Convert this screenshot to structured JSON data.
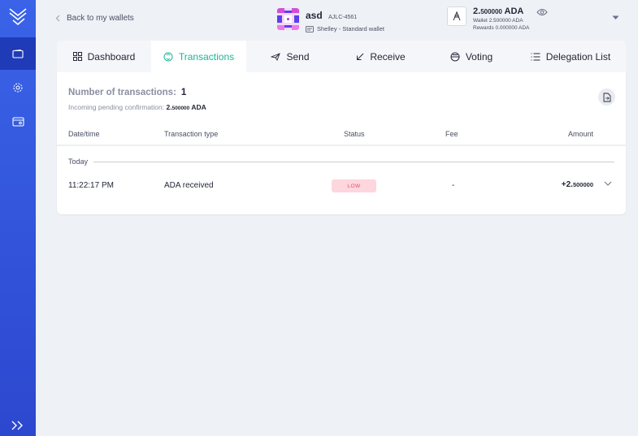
{
  "nav": {
    "back_label": "Back to my wallets"
  },
  "wallet": {
    "name": "asd",
    "plate": "AJLC-4561",
    "type": "Shelley - Standard wallet"
  },
  "balance": {
    "main_int": "2.",
    "main_dec": "500000",
    "main_unit": " ADA",
    "wallet_line": "Wallet 2.500000 ADA",
    "rewards_line": "Rewards 0.000000 ADA"
  },
  "tabs": [
    {
      "label": "Dashboard",
      "icon": "grid-icon",
      "active": false
    },
    {
      "label": "Transactions",
      "icon": "transactions-icon",
      "active": true
    },
    {
      "label": "Send",
      "icon": "send-icon",
      "active": false
    },
    {
      "label": "Receive",
      "icon": "receive-icon",
      "active": false
    },
    {
      "label": "Voting",
      "icon": "voting-icon",
      "active": false
    },
    {
      "label": "Delegation List",
      "icon": "list-icon",
      "active": false
    }
  ],
  "summary": {
    "count_label": "Number of transactions:",
    "count_value": "1",
    "pending_label": "Incoming pending confirmation:",
    "pending_int": "2.",
    "pending_dec": "500000",
    "pending_unit": " ADA"
  },
  "table": {
    "headers": [
      "Date/time",
      "Transaction type",
      "Status",
      "Fee",
      "Amount"
    ],
    "groups": [
      {
        "day": "Today",
        "rows": [
          {
            "time": "11:22:17 PM",
            "type": "ADA received",
            "status": "LOW",
            "fee": "-",
            "amount_int": "+2.",
            "amount_dec": "500000"
          }
        ]
      }
    ]
  },
  "colors": {
    "accent": "#17b897",
    "sidebar": "#3a63e8",
    "status_bg": "#fdd6de",
    "status_text": "#e84d6a"
  }
}
